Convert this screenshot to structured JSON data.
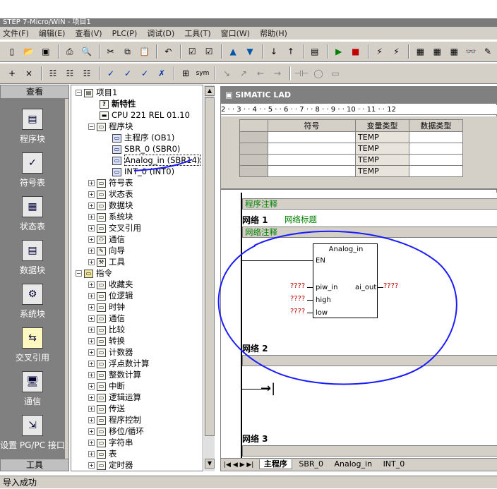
{
  "window": {
    "title": "STEP 7-Micro/WIN - 项目1"
  },
  "menu": [
    "文件(F)",
    "编辑(E)",
    "查看(V)",
    "PLC(P)",
    "调试(D)",
    "工具(T)",
    "窗口(W)",
    "帮助(H)"
  ],
  "navbar": {
    "header": "查看",
    "items": [
      "程序块",
      "符号表",
      "状态表",
      "数据块",
      "系统块",
      "交叉引用",
      "通信",
      "设置 PG/PC 接口"
    ],
    "footer": "工具"
  },
  "tree": {
    "rows": [
      {
        "label": "项目1"
      },
      {
        "label": "新特性"
      },
      {
        "label": "CPU 221 REL 01.10"
      },
      {
        "label": "程序块"
      },
      {
        "label": "主程序 (OB1)"
      },
      {
        "label": "SBR_0 (SBR0)"
      },
      {
        "label": "Analog_in (SBR14)"
      },
      {
        "label": "INT_0 (INT0)"
      },
      {
        "label": "符号表"
      },
      {
        "label": "状态表"
      },
      {
        "label": "数据块"
      },
      {
        "label": "系统块"
      },
      {
        "label": "交叉引用"
      },
      {
        "label": "通信"
      },
      {
        "label": "向导"
      },
      {
        "label": "工具"
      },
      {
        "label": "指令"
      },
      {
        "label": "收藏夹"
      },
      {
        "label": "位逻辑"
      },
      {
        "label": "时钟"
      },
      {
        "label": "通信"
      },
      {
        "label": "比较"
      },
      {
        "label": "转换"
      },
      {
        "label": "计数器"
      },
      {
        "label": "浮点数计算"
      },
      {
        "label": "整数计算"
      },
      {
        "label": "中断"
      },
      {
        "label": "逻辑运算"
      },
      {
        "label": "传送"
      },
      {
        "label": "程序控制"
      },
      {
        "label": "移位/循环"
      },
      {
        "label": "字符串"
      },
      {
        "label": "表"
      },
      {
        "label": "定时器"
      }
    ]
  },
  "editor": {
    "title": "SIMATIC LAD",
    "ruler": "2 · · 3 · · 4 · · 5 · · 6 · · 7 · · 8 · · 9 · · 10 · · 11 · · 12",
    "var_table": {
      "headers": [
        "符号",
        "变量类型",
        "数据类型"
      ],
      "rows": [
        {
          "var_type": "TEMP"
        },
        {
          "var_type": "TEMP"
        },
        {
          "var_type": "TEMP"
        },
        {
          "var_type": "TEMP"
        }
      ]
    },
    "program_comment": "程序注释",
    "network1": {
      "label": "网络 1",
      "title": "网络标题",
      "comment": "网络注释"
    },
    "block": {
      "name": "Analog_in",
      "en": "EN",
      "inputs": [
        "piw_in",
        "high",
        "low"
      ],
      "output": "ai_out",
      "placeholder": "????"
    },
    "network2": {
      "label": "网络 2"
    },
    "network3": {
      "label": "网络 3"
    },
    "tabs": [
      "主程序",
      "SBR_0",
      "Analog_in",
      "INT_0"
    ]
  },
  "status": {
    "text": "导入成功"
  },
  "colors": {
    "annotation": "#1a1aff",
    "comment_text": "#008000",
    "placeholder": "#c00000"
  }
}
